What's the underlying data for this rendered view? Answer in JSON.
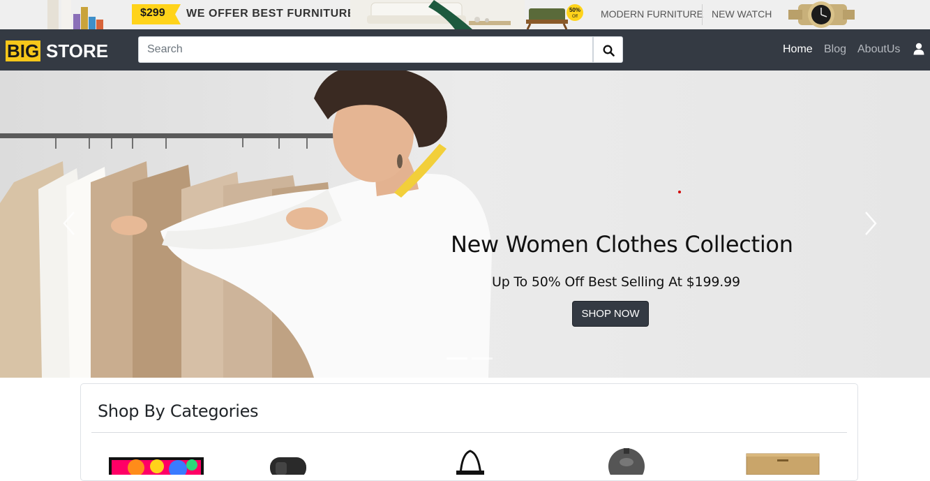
{
  "promo": {
    "price": "$299",
    "tagline": "WE OFFER BEST FURNITURE",
    "discount_badge": "50% Off",
    "link_modern": "MODERN FURNITURE",
    "link_watch": "NEW WATCH"
  },
  "header": {
    "logo_big": "BIG",
    "logo_store": "STORE",
    "search_placeholder": "Search",
    "search_icon": "search-icon",
    "nav": [
      {
        "label": "Home",
        "active": true
      },
      {
        "label": "Blog",
        "active": false
      },
      {
        "label": "AboutUs",
        "active": false
      }
    ],
    "user_icon": "user-icon"
  },
  "hero": {
    "title": "New Women Clothes Collection",
    "subtitle": "Up To 50% Off Best Selling At $199.99",
    "cta": "SHOP NOW",
    "slides_count": 2,
    "active_slide": 1
  },
  "categories": {
    "title": "Shop By Categories",
    "items": [
      "laptop-icon",
      "speaker-icon",
      "handbag-icon",
      "wall-lamp-icon",
      "cabinet-icon"
    ]
  },
  "colors": {
    "navbar": "#343a43",
    "logo_accent": "#f7c71a",
    "button_dark": "#343a43"
  }
}
